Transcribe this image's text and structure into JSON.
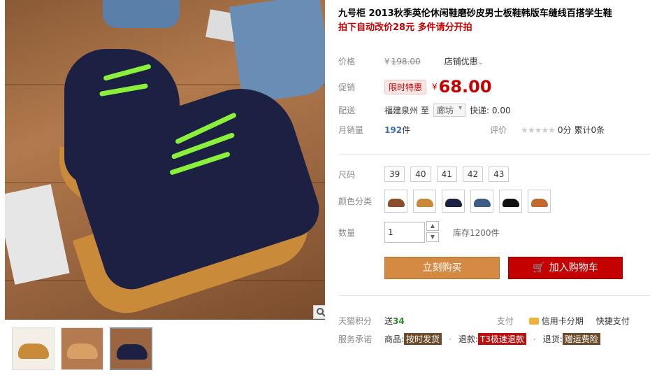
{
  "product": {
    "title": "九号柜 2013秋季英伦休闲鞋磨砂皮男士板鞋韩版车缝线百搭学生鞋",
    "subtitle": "拍下自动改价28元 多件请分开拍"
  },
  "price": {
    "label": "价格",
    "currency": "¥",
    "original": "198.00",
    "shop_discount": "店铺优惠"
  },
  "promo": {
    "label": "促销",
    "tag": "限时特惠",
    "currency": "¥",
    "price": "68.00"
  },
  "shipping": {
    "label": "配送",
    "from": "福建泉州",
    "to_word": "至",
    "destination": "廊坊",
    "express": "快递: 0.00"
  },
  "sales": {
    "label": "月销量",
    "count": "192",
    "unit": "件",
    "rating_label": "评价",
    "stars": "★★★★★",
    "score": "0分",
    "total_reviews": "累计0条"
  },
  "size": {
    "label": "尺码",
    "options": [
      "39",
      "40",
      "41",
      "42",
      "43"
    ]
  },
  "colors": {
    "label": "颜色分类",
    "swatches": [
      "#8a4e2a",
      "#c9883a",
      "#1c2143",
      "#3c5c84",
      "#111111",
      "#c06a30"
    ]
  },
  "quantity": {
    "label": "数量",
    "value": "1",
    "stock": "库存1200件"
  },
  "actions": {
    "buy": "立刻购买",
    "cart": "加入购物车"
  },
  "points": {
    "label": "天猫积分",
    "send": "送",
    "amount": "34",
    "pay_label": "支付",
    "credit": "信用卡分期",
    "quick": "快捷支付"
  },
  "service": {
    "label": "服务承诺",
    "goods": "商品:",
    "goods_tag": "按时发货",
    "refund": "退款:",
    "refund_tag": "T3极速退款",
    "return": "退货:",
    "return_tag": "赠运费险"
  },
  "colors_theme": {
    "accent_red": "#c40000",
    "buy_orange": "#d58a44",
    "lace_green": "#8af03c"
  }
}
